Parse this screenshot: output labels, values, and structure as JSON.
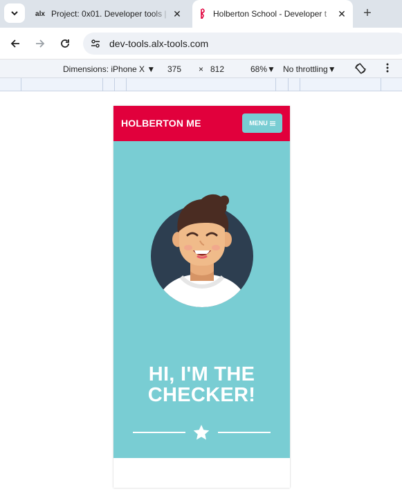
{
  "browser": {
    "tabs": [
      {
        "favicon": "alx",
        "title": "Project: 0x01. Developer tools |",
        "active": false
      },
      {
        "favicon": "holberton-icon",
        "title": "Holberton School - Developer t",
        "active": true
      }
    ],
    "url": "dev-tools.alx-tools.com"
  },
  "devtools": {
    "dimensions_label": "Dimensions: iPhone X",
    "width": "375",
    "times": "×",
    "height": "812",
    "zoom": "68%",
    "throttling": "No throttling"
  },
  "page": {
    "brand": "HOLBERTON ME",
    "menu_label": "MENU",
    "hero_line1": "HI, I'M THE",
    "hero_line2": "CHECKER!"
  },
  "colors": {
    "brand_red": "#e1003c",
    "hero_teal": "#79cdd3",
    "avatar_bg": "#2d3e50"
  }
}
